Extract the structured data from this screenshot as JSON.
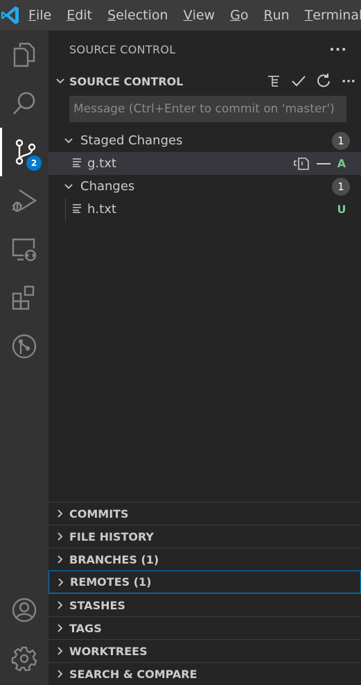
{
  "menubar": {
    "items": [
      {
        "mnemonic": "F",
        "rest": "ile"
      },
      {
        "mnemonic": "E",
        "rest": "dit"
      },
      {
        "mnemonic": "S",
        "rest": "election"
      },
      {
        "mnemonic": "V",
        "rest": "iew"
      },
      {
        "mnemonic": "G",
        "rest": "o"
      },
      {
        "mnemonic": "R",
        "rest": "un"
      },
      {
        "mnemonic": "T",
        "rest": "erminal"
      }
    ]
  },
  "activity_bar": {
    "items": [
      "explorer-icon",
      "search-icon",
      "source-control-icon",
      "run-debug-icon",
      "remote-explorer-icon",
      "extensions-icon",
      "gitlens-icon"
    ],
    "source_control_badge": "2",
    "bottom": [
      "accounts-icon",
      "manage-gear-icon"
    ]
  },
  "sidebar": {
    "title": "SOURCE CONTROL",
    "more": "···",
    "section_title": "SOURCE CONTROL",
    "commit_placeholder": "Message (Ctrl+Enter to commit on 'master')",
    "staged": {
      "label": "Staged Changes",
      "count": "1",
      "files": [
        {
          "name": "g.txt",
          "status": "A"
        }
      ]
    },
    "changes": {
      "label": "Changes",
      "count": "1",
      "files": [
        {
          "name": "h.txt",
          "status": "U"
        }
      ]
    }
  },
  "panels": [
    {
      "title": "COMMITS"
    },
    {
      "title": "FILE HISTORY"
    },
    {
      "title": "BRANCHES (1)"
    },
    {
      "title": "REMOTES (1)"
    },
    {
      "title": "STASHES"
    },
    {
      "title": "TAGS"
    },
    {
      "title": "WORKTREES"
    },
    {
      "title": "SEARCH & COMPARE"
    }
  ],
  "colors": {
    "accent": "#007acc",
    "added": "#73c991",
    "untracked": "#73c991"
  }
}
